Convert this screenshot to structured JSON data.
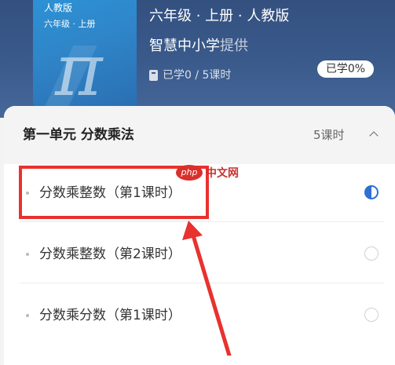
{
  "course": {
    "cover": {
      "edition": "人教版",
      "grade_term": "六年级 · 上册",
      "symbol": "π"
    },
    "meta": "六年级 · 上册 · 人教版",
    "provider_org": "智慧中小学",
    "provider_suffix": "提供",
    "progress_text": "已学0 / 5课时",
    "progress_badge": "已学0%"
  },
  "unit": {
    "title": "第一单元 分数乘法",
    "count": "5课时"
  },
  "lessons": [
    {
      "name": "分数乘整数（第1课时）",
      "state": "half"
    },
    {
      "name": "分数乘整数（第2课时）",
      "state": "empty"
    },
    {
      "name": "分数乘分数（第1课时）",
      "state": "empty"
    }
  ],
  "watermark": {
    "logo": "php",
    "text": "中文网"
  },
  "colors": {
    "header": "#3b5b8d",
    "annotation": "#e8322e",
    "accent": "#2f6fd1"
  }
}
